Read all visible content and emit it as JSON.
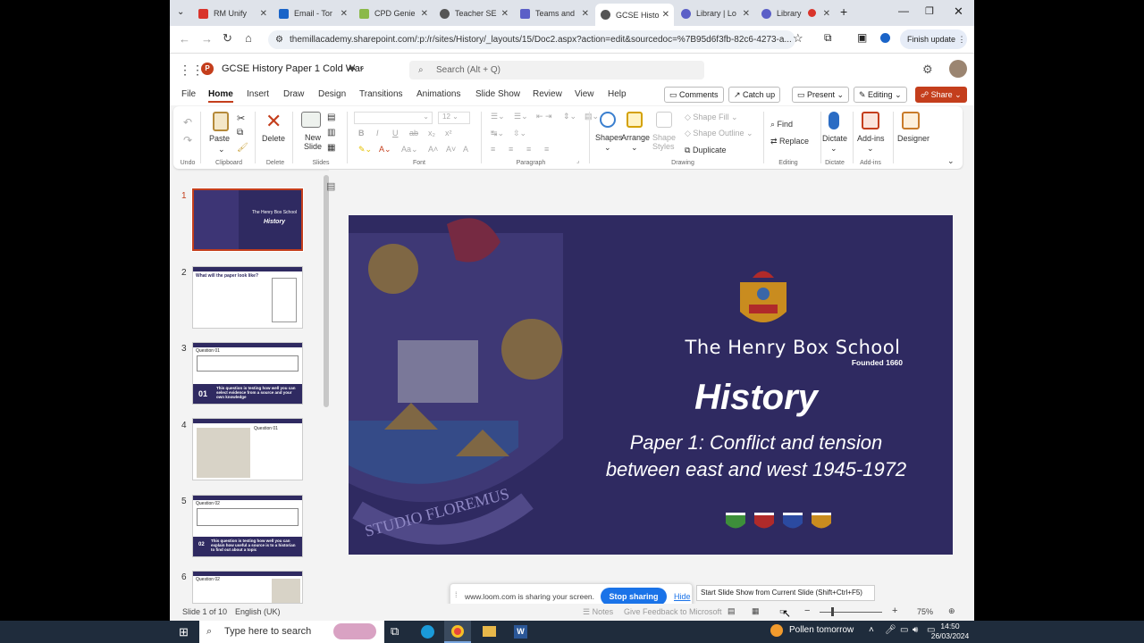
{
  "browser": {
    "tabs": [
      {
        "label": "RM Unify",
        "icon_color": "#d9342b"
      },
      {
        "label": "Email - Tor",
        "icon_color": "#1a64c8"
      },
      {
        "label": "CPD Genie",
        "icon_color": "#8bb94a"
      },
      {
        "label": "Teacher SE",
        "icon_color": "#555555"
      },
      {
        "label": "Teams and",
        "icon_color": "#5b5fc7"
      },
      {
        "label": "GCSE Histo",
        "icon_color": "#555555"
      },
      {
        "label": "Library | Lo",
        "icon_color": "#5b5fc7"
      },
      {
        "label": "Library",
        "icon_color": "#5b5fc7"
      }
    ],
    "url": "themillacademy.sharepoint.com/:p:/r/sites/History/_layouts/15/Doc2.aspx?action=edit&sourcedoc=%7B95d6f3fb-82c6-4273-a...",
    "finish_update": "Finish update"
  },
  "app": {
    "doc_title": "GCSE History Paper 1 Cold War",
    "search_placeholder": "Search (Alt + Q)",
    "menus": [
      "File",
      "Home",
      "Insert",
      "Draw",
      "Design",
      "Transitions",
      "Animations",
      "Slide Show",
      "Review",
      "View",
      "Help"
    ],
    "active_menu": "Home",
    "comments": "Comments",
    "catchup": "Catch up",
    "present": "Present",
    "editing": "Editing",
    "share": "Share",
    "accent": "#c43e1c"
  },
  "ribbon": {
    "undo_group": "Undo",
    "paste": "Paste",
    "clipboard": "Clipboard",
    "delete": "Delete",
    "delete_group": "Delete",
    "new_slide": "New Slide",
    "slides_group": "Slides",
    "font_size": "12",
    "font_group": "Font",
    "paragraph_group": "Paragraph",
    "shapes": "Shapes",
    "arrange": "Arrange",
    "shape_styles": "Shape Styles",
    "shape_fill": "Shape Fill",
    "shape_outline": "Shape Outline",
    "duplicate": "Duplicate",
    "drawing_group": "Drawing",
    "find": "Find",
    "replace": "Replace",
    "editing_group": "Editing",
    "dictate": "Dictate",
    "dictate_group": "Dictate",
    "addins": "Add-ins",
    "addins_group": "Add-ins",
    "designer": "Designer"
  },
  "thumbnails": {
    "numbers": [
      "1",
      "2",
      "3",
      "4",
      "5",
      "6"
    ],
    "t2_title": "What will the paper look like?",
    "t3_title": "Question 01",
    "t3_num": "01",
    "t3_text": "This question is testing how well you can select evidence from a source and your own knowledge",
    "t4_title": "Question 01",
    "t5_title": "Question 02",
    "t5_num": "02",
    "t5_text": "This question is testing how well you can explain how useful a source is to a historian to find out about a topic",
    "t6_title": "Question 02"
  },
  "slide": {
    "school": "The Henry Box School",
    "founded": "Founded 1660",
    "title": "History",
    "subtitle_line1": "Paper 1: Conflict and tension",
    "subtitle_line2": "between east and west 1945-1972",
    "motto": "STUDIO FLOREMUS",
    "bg_color": "#2f2a61"
  },
  "loom": {
    "message": "www.loom.com is sharing your screen.",
    "stop": "Stop sharing",
    "hide": "Hide"
  },
  "tooltip": "Start Slide Show from Current Slide (Shift+Ctrl+F5)",
  "status": {
    "slide_info": "Slide 1 of 10",
    "language": "English (UK)",
    "notes": "Notes",
    "feedback": "Give Feedback to Microsoft",
    "zoom": "75%"
  },
  "taskbar": {
    "search": "Type here to search",
    "weather": "Pollen tomorrow",
    "time": "14:50",
    "date": "26/03/2024"
  }
}
